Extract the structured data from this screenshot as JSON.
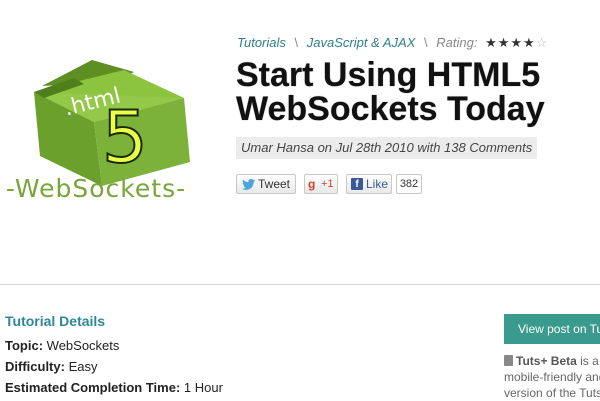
{
  "logo": {
    "folder_text": ".html",
    "number": "5",
    "wordmark": "-WebSockets-",
    "colors": {
      "folder": "#7cb23a",
      "folder_dark": "#4e7f1d",
      "wordmark": "#78a43a"
    }
  },
  "breadcrumb": {
    "items": [
      "Tutorials",
      "JavaScript & AJAX"
    ],
    "separator": "\\",
    "rating_label": "Rating:",
    "rating_stars": "★★★★",
    "rating_empty": "☆",
    "rating_value": 4,
    "rating_max": 5
  },
  "article": {
    "title_line1": "Start Using HTML5",
    "title_line2": "WebSockets Today",
    "byline": "Umar Hansa on Jul 28th 2010 with 138 Comments"
  },
  "social": {
    "tweet_label": "Tweet",
    "gplus_label": "+1",
    "gplus_icon": "g",
    "fb_icon": "f",
    "fb_label": "Like",
    "fb_count": "382",
    "colors": {
      "twitter": "#4aa7d8",
      "gplus": "#d44132",
      "facebook": "#3b5998"
    }
  },
  "details": {
    "heading": "Tutorial Details",
    "rows": [
      {
        "label": "Topic:",
        "value": "WebSockets"
      },
      {
        "label": "Difficulty:",
        "value": "Easy"
      },
      {
        "label": "Estimated Completion Time:",
        "value": "1 Hour"
      }
    ]
  },
  "sidebar": {
    "view_button": "View post on Tuts+",
    "beta_title": "Tuts+ Beta",
    "beta_text_1": "is a",
    "beta_text_2": "mobile-friendly and",
    "beta_text_3": "version of the Tuts+",
    "accent": "#3a9a8d"
  }
}
